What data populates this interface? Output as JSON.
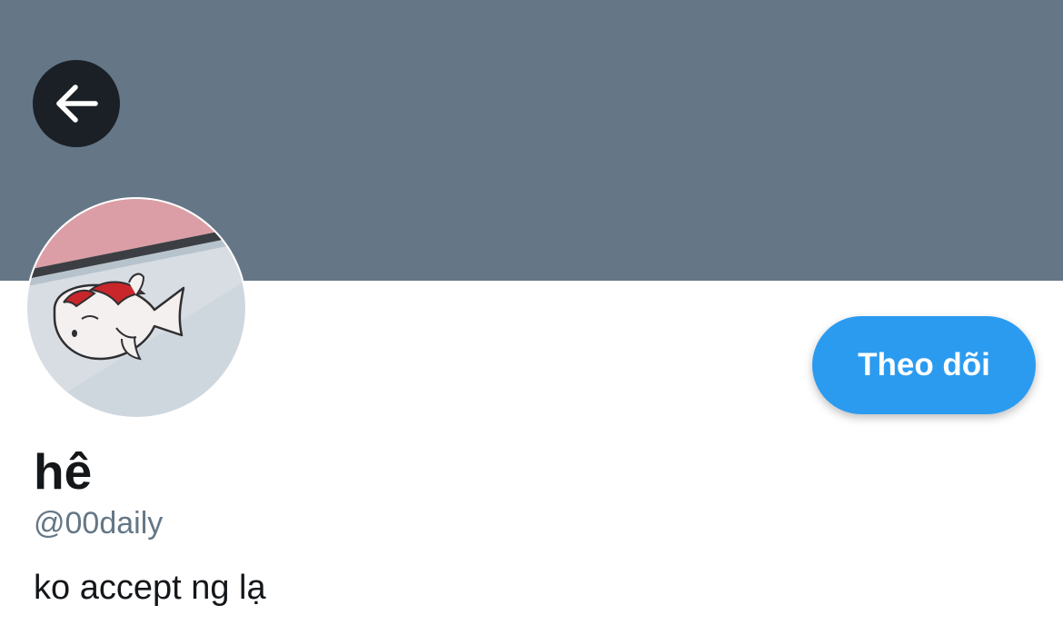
{
  "colors": {
    "banner": "#657786",
    "back_button": "#1b2026",
    "follow_button": "#2b9bf0",
    "handle_text": "#657786"
  },
  "header": {
    "back_icon": "arrow-left-icon"
  },
  "profile": {
    "display_name": "hê",
    "handle": "@00daily",
    "bio": "ko accept ng lạ",
    "follow_label": "Theo dõi"
  }
}
